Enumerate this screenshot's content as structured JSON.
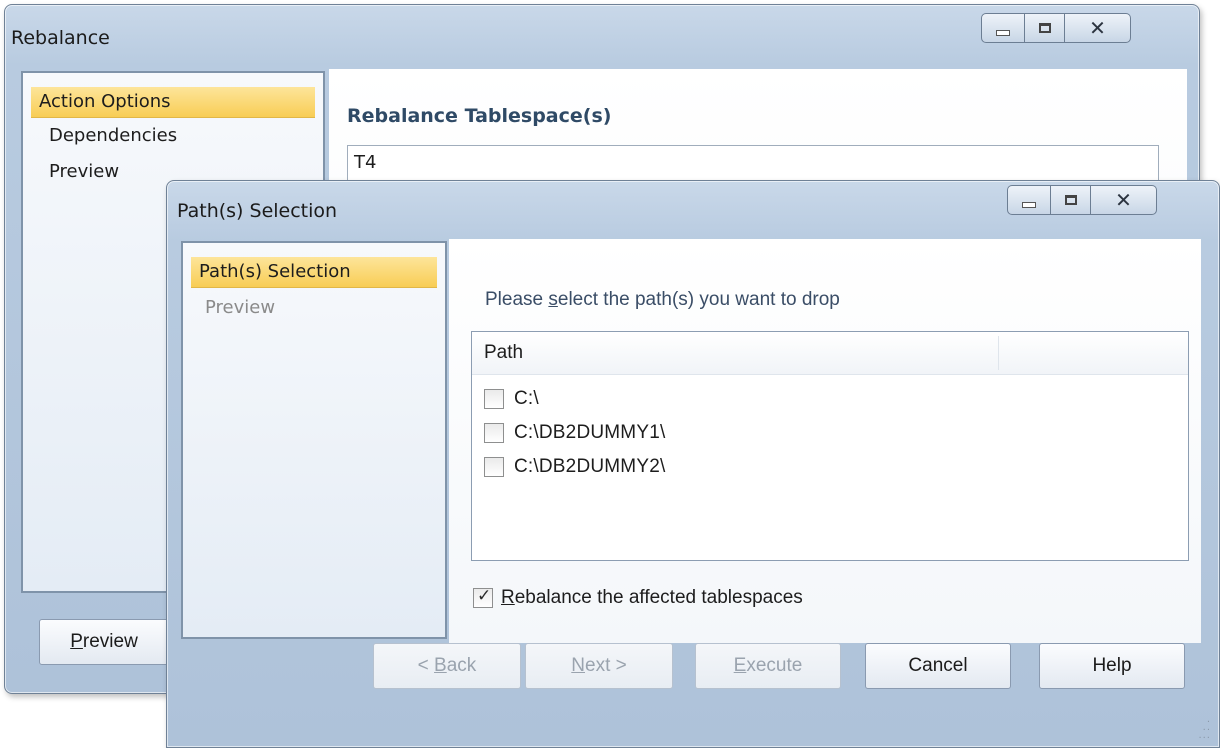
{
  "rebalance_window": {
    "title": "Rebalance",
    "nav": [
      "Action Options",
      "Dependencies",
      "Preview"
    ],
    "section_title": "Rebalance Tablespace(s)",
    "tablespace_value": "T4",
    "preview_button": "Preview",
    "preview_button_mnemonic": "P",
    "preview_button_rest": "review"
  },
  "path_window": {
    "title": "Path(s) Selection",
    "nav": [
      "Path(s) Selection",
      "Preview"
    ],
    "prompt": {
      "before": "Please ",
      "mnemonic": "s",
      "after": "elect the path(s) you want to drop"
    },
    "list": {
      "column_header": "Path",
      "rows": [
        {
          "label": "C:\\",
          "checked": false
        },
        {
          "label": "C:\\DB2DUMMY1\\",
          "checked": false
        },
        {
          "label": "C:\\DB2DUMMY2\\",
          "checked": false
        }
      ]
    },
    "rebalance_checkbox": {
      "checked": true,
      "mnemonic": "R",
      "rest": "ebalance the affected tablespaces"
    },
    "buttons": {
      "back": {
        "before": "< ",
        "mnemonic": "B",
        "after": "ack"
      },
      "next": {
        "mnemonic": "N",
        "after": "ext >"
      },
      "execute": {
        "mnemonic": "E",
        "after": "xecute"
      },
      "cancel": "Cancel",
      "help": "Help"
    }
  },
  "icons": {
    "minimize": "minimize-icon",
    "maximize": "maximize-icon",
    "close": "close-icon",
    "checkmark": "checkmark-icon",
    "resize_grip": "resize-grip-icon"
  },
  "colors": {
    "nav_selected": "#f8cd55",
    "window_frame": "#b8cbe0"
  }
}
